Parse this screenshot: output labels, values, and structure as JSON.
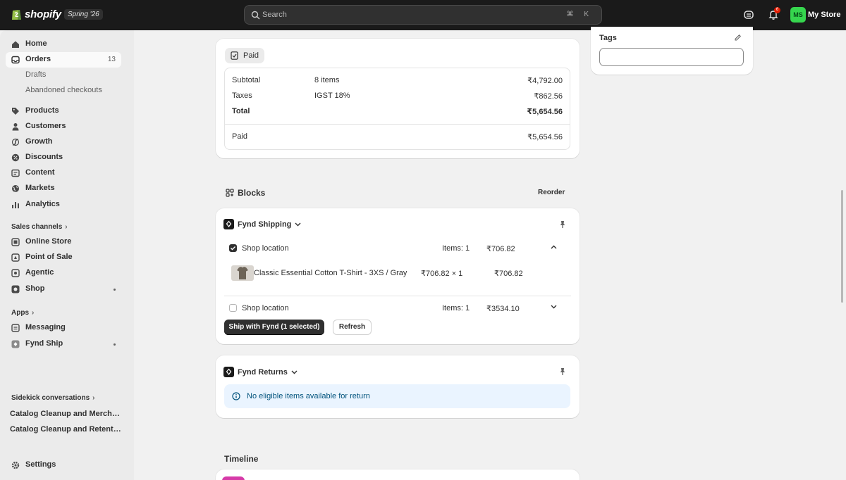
{
  "topbar": {
    "brand": "shopify",
    "edition": "Spring '26",
    "search_placeholder": "Search",
    "search_shortcut": "⌘ K",
    "notification_count": "6",
    "avatar_initials": "MS",
    "store_name": "My Store",
    "accent": "#36d64e"
  },
  "sidebar": {
    "home": "Home",
    "orders": "Orders",
    "orders_count": "13",
    "drafts": "Drafts",
    "abandoned": "Abandoned checkouts",
    "products": "Products",
    "customers": "Customers",
    "growth": "Growth",
    "discounts": "Discounts",
    "content": "Content",
    "markets": "Markets",
    "analytics": "Analytics",
    "sales_channels": "Sales channels",
    "online_store": "Online Store",
    "pos": "Point of Sale",
    "agentic": "Agentic",
    "shop": "Shop",
    "apps": "Apps",
    "messaging": "Messaging",
    "fynd_ship": "Fynd Ship",
    "sidekick": "Sidekick conversations",
    "conv1": "Catalog Cleanup and Merchandising",
    "conv2": "Catalog Cleanup and Retention",
    "settings": "Settings"
  },
  "payment": {
    "status": "Paid",
    "subtotal_label": "Subtotal",
    "subtotal_items": "8 items",
    "subtotal_value": "₹4,792.00",
    "taxes_label": "Taxes",
    "taxes_desc": "IGST 18%",
    "taxes_value": "₹862.56",
    "total_label": "Total",
    "total_value": "₹5,654.56",
    "paid_label": "Paid",
    "paid_value": "₹5,654.56"
  },
  "blocks": {
    "title": "Blocks",
    "reorder": "Reorder"
  },
  "fynd_shipping": {
    "title": "Fynd Shipping",
    "loc1": "Shop location",
    "loc1_items": "Items: 1",
    "loc1_amount": "₹706.82",
    "product_name": "Classic Essential Cotton T-Shirt - 3XS / Gray",
    "product_qty": "₹706.82 × 1",
    "product_total": "₹706.82",
    "loc2": "Shop location",
    "loc2_items": "Items: 1",
    "loc2_amount": "₹3534.10",
    "ship_button": "Ship with Fynd (1 selected)",
    "refresh_button": "Refresh"
  },
  "fynd_returns": {
    "title": "Fynd Returns",
    "message": "No eligible items available for return"
  },
  "tags": {
    "title": "Tags"
  },
  "timeline": {
    "title": "Timeline"
  }
}
